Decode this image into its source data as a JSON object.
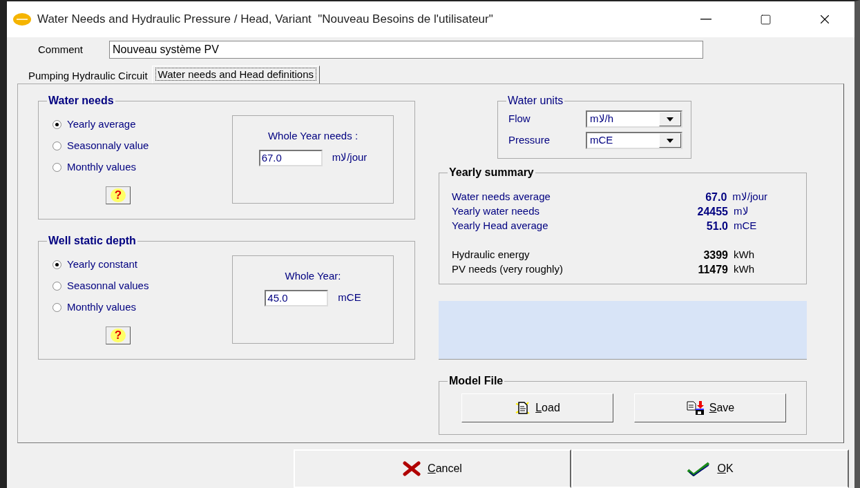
{
  "window": {
    "title": "Water Needs and Hydraulic Pressure / Head, Variant  \"Nouveau Besoins de l'utilisateur\""
  },
  "comment": {
    "label": "Comment",
    "value": "Nouveau système PV"
  },
  "tabs": [
    {
      "label": "Pumping Hydraulic Circuit",
      "selected": false
    },
    {
      "label": "Water needs and Head definitions",
      "selected": true
    }
  ],
  "water_needs": {
    "title": "Water needs",
    "options": [
      {
        "label": "Yearly average",
        "selected": true
      },
      {
        "label": "Seasonnaly value",
        "selected": false
      },
      {
        "label": "Monthly values",
        "selected": false
      }
    ],
    "help": "?",
    "value_label": "Whole Year needs :",
    "value": "67.0",
    "unit": "mﻻ/jour"
  },
  "well_static_depth": {
    "title": "Well static depth",
    "options": [
      {
        "label": "Yearly constant",
        "selected": true
      },
      {
        "label": "Seasonnal values",
        "selected": false
      },
      {
        "label": "Monthly values",
        "selected": false
      }
    ],
    "help": "?",
    "value_label": "Whole Year:",
    "value": "45.0",
    "unit": "mCE"
  },
  "water_units": {
    "title": "Water units",
    "fields": [
      {
        "label": "Flow",
        "value": "mﻻ/h"
      },
      {
        "label": "Pressure",
        "value": "mCE"
      }
    ]
  },
  "yearly_summary": {
    "title": "Yearly summary",
    "rows": [
      {
        "label": "Water needs average",
        "value": "67.0",
        "unit": "mﻻ/jour",
        "kind": "water"
      },
      {
        "label": "Yearly water needs",
        "value": "24455",
        "unit": "mﻻ",
        "kind": "water"
      },
      {
        "label": "Yearly Head average",
        "value": "51.0",
        "unit": "mCE",
        "kind": "water"
      },
      {
        "label": "Hydraulic energy",
        "value": "3399",
        "unit": "kWh",
        "kind": "energy"
      },
      {
        "label": "PV needs (very roughly)",
        "value": "11479",
        "unit": "kWh",
        "kind": "energy"
      }
    ]
  },
  "model_file": {
    "title": "Model File",
    "buttons": [
      {
        "label": "Load",
        "kind": "load"
      },
      {
        "label": "Save",
        "kind": "save"
      }
    ]
  },
  "footer_buttons": [
    {
      "label": "Cancel",
      "kind": "cancel"
    },
    {
      "label": "OK",
      "kind": "ok"
    }
  ]
}
